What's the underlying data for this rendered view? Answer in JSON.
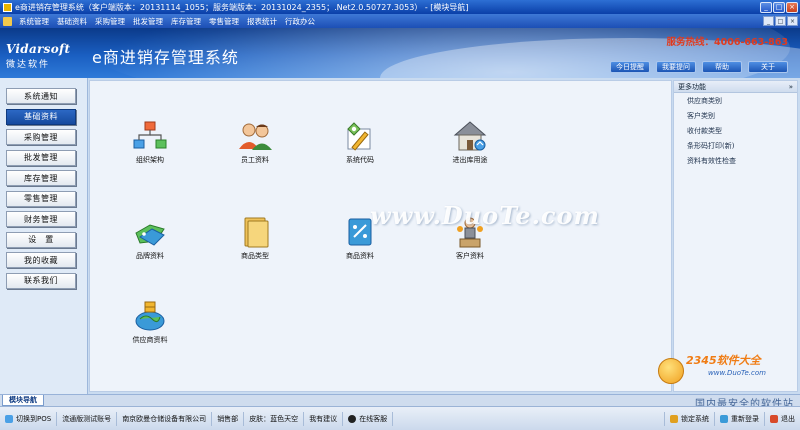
{
  "window": {
    "title": "e商进销存管理系统（客户端版本：20131114_1055；服务端版本：20131024_2355；.Net2.0.50727.3053） - [模块导航]",
    "buttons": [
      "_",
      "□",
      "×"
    ]
  },
  "menu": {
    "items": [
      "系统管理",
      "基础资料",
      "采购管理",
      "批发管理",
      "库存管理",
      "零售管理",
      "报表统计",
      "行政办公"
    ],
    "mdi_buttons": [
      "_",
      "□",
      "×"
    ]
  },
  "header": {
    "logo_en": "Vidarsoft",
    "logo_cn": "微达软件",
    "app_title": "e商进销存管理系统",
    "hotline": "服务热线：4006-663-863",
    "buttons": [
      "今日提醒",
      "我要提问",
      "帮助",
      "关于"
    ]
  },
  "sidebar": {
    "items": [
      {
        "label": "系统通知",
        "active": false
      },
      {
        "label": "基础资料",
        "active": true
      },
      {
        "label": "采购管理",
        "active": false
      },
      {
        "label": "批发管理",
        "active": false
      },
      {
        "label": "库存管理",
        "active": false
      },
      {
        "label": "零售管理",
        "active": false
      },
      {
        "label": "财务管理",
        "active": false
      },
      {
        "label": "设　置",
        "active": false
      },
      {
        "label": "我的收藏",
        "active": false
      },
      {
        "label": "联系我们",
        "active": false
      }
    ]
  },
  "modules": [
    {
      "label": "组织架构",
      "icon": "org-chart-icon"
    },
    {
      "label": "员工资料",
      "icon": "people-icon"
    },
    {
      "label": "系统代码",
      "icon": "code-pencil-icon"
    },
    {
      "label": "进出库用途",
      "icon": "house-icon"
    },
    {
      "label": "品牌资料",
      "icon": "tag-icon"
    },
    {
      "label": "商品类型",
      "icon": "folder-icon"
    },
    {
      "label": "商品资料",
      "icon": "product-icon"
    },
    {
      "label": "客户资料",
      "icon": "customer-icon"
    },
    {
      "label": "供应商资料",
      "icon": "globe-supplier-icon"
    }
  ],
  "watermark": "www.DuoTe.com",
  "right_panel": {
    "title": "更多功能",
    "collapse": "»",
    "items": [
      "供应商类别",
      "客户类别",
      "收付款类型",
      "条形码打印(新)",
      "资料有效性检查"
    ]
  },
  "badge": {
    "title": "2345软件大全",
    "url": "www.DuoTe.com"
  },
  "tab": {
    "label": "模块导航"
  },
  "slogan": "国内最安全的软件站",
  "status": {
    "left": [
      "切换到POS",
      "流通版测试账号",
      "南京欧曼仓储设备有限公司",
      "销售部",
      "皮肤：蓝色天空",
      "我有建议",
      "在线客服"
    ],
    "right": [
      "锁定系统",
      "重新登录",
      "退出"
    ]
  },
  "colors": {
    "accent": "#1c55b5",
    "hotline": "#e03a1e"
  }
}
